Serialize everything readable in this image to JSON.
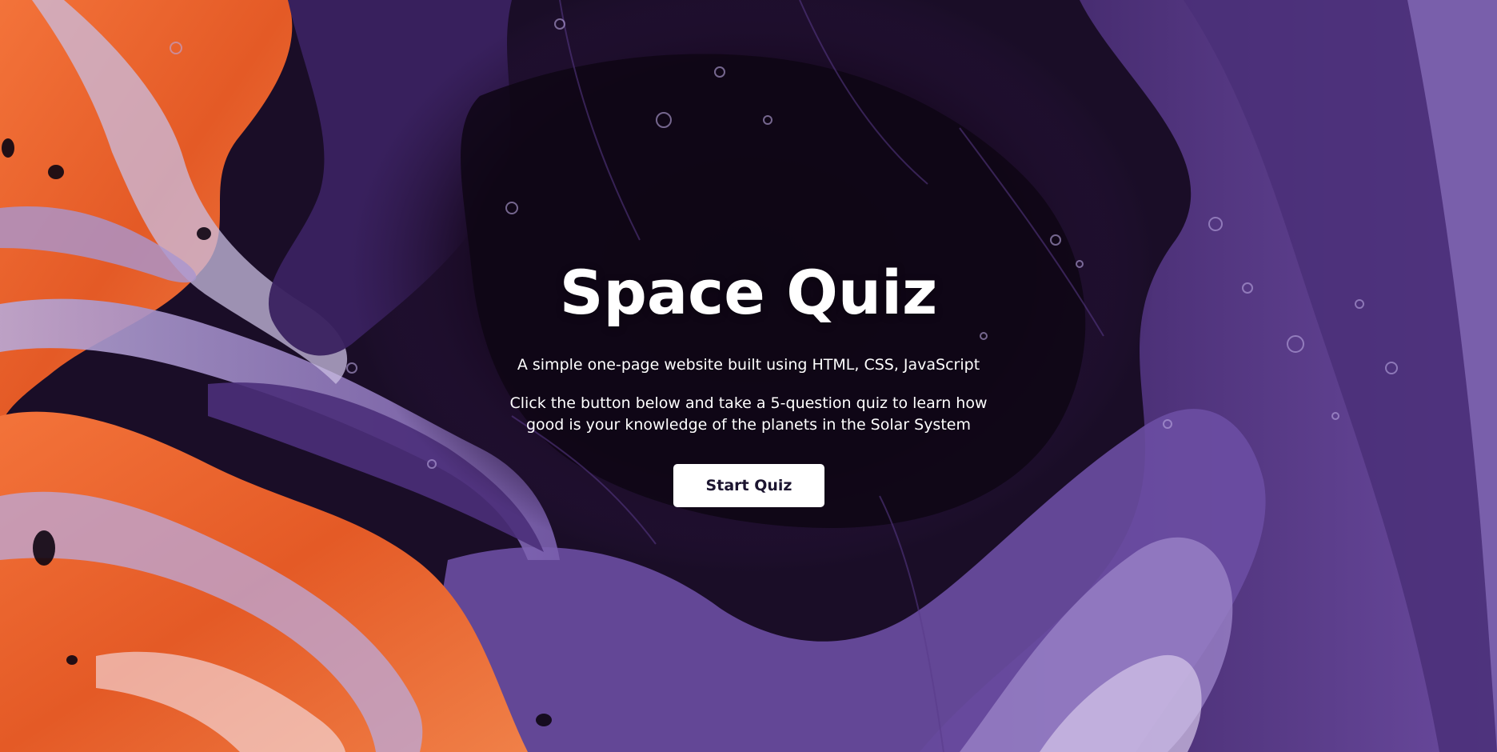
{
  "hero": {
    "title": "Space Quiz",
    "subtitle": "A simple one-page website built using HTML, CSS, JavaScript",
    "description": "Click the button below and take a 5-question quiz to learn how good is your knowledge of the planets in the Solar System",
    "start_button_label": "Start Quiz"
  },
  "colors": {
    "text": "#ffffff",
    "button_bg": "#ffffff",
    "button_text": "#1c1530",
    "background_dark": "#0d0612",
    "background_purple": "#5b3f8f",
    "background_orange": "#f06a2c"
  }
}
